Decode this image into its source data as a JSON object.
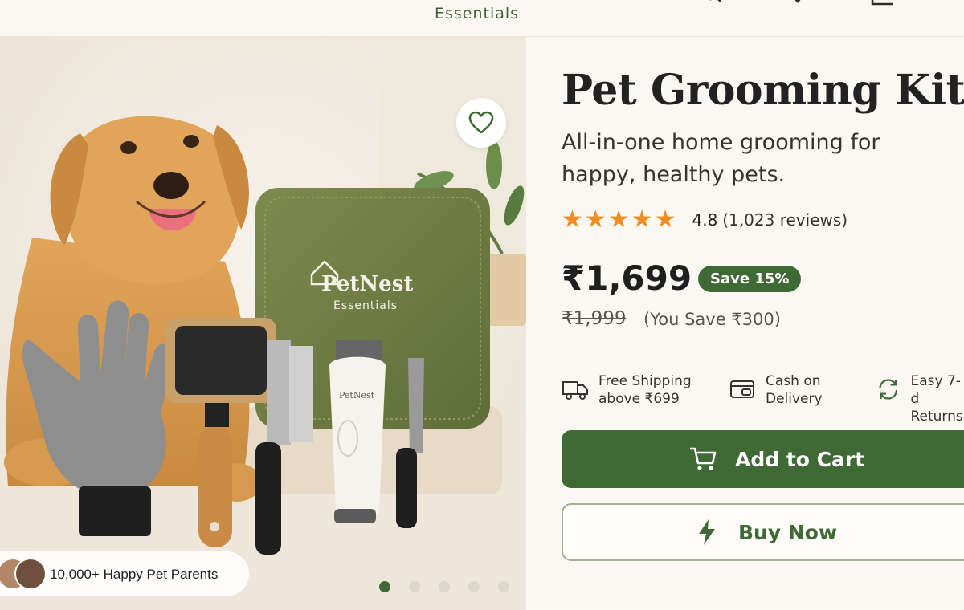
{
  "header": {
    "brand_tagline": "Essentials",
    "icons": [
      "search-icon",
      "heart-icon",
      "bag-icon"
    ]
  },
  "gallery": {
    "kit_brand": "PetNest",
    "kit_sub": "Essentials",
    "trimmer_brand": "PetNest",
    "social_proof": "10,000+ Happy Pet Parents",
    "slide_count": 5,
    "active_slide": 1
  },
  "product": {
    "title": "Pet Grooming Kit",
    "subtitle": "All-in-one home grooming for happy, healthy pets.",
    "stars": "★★★★★",
    "rating": "4.8",
    "review_count": "(1,023 reviews)",
    "price": "₹1,699",
    "discount_badge": "Save 15%",
    "mrp": "₹1,999",
    "savings": "(You Save ₹300)"
  },
  "features": [
    {
      "icon": "truck-icon",
      "line1": "Free Shipping",
      "line2": "above ₹699"
    },
    {
      "icon": "cash-icon",
      "line1": "Cash on",
      "line2": "Delivery"
    },
    {
      "icon": "return-icon",
      "line1": "Easy 7-d",
      "line2": "Returns"
    }
  ],
  "actions": {
    "add_to_cart": "Add to Cart",
    "buy_now": "Buy Now"
  },
  "colors": {
    "accent": "#3f6a36",
    "star": "#f28b21",
    "background": "#f8f4ee"
  }
}
